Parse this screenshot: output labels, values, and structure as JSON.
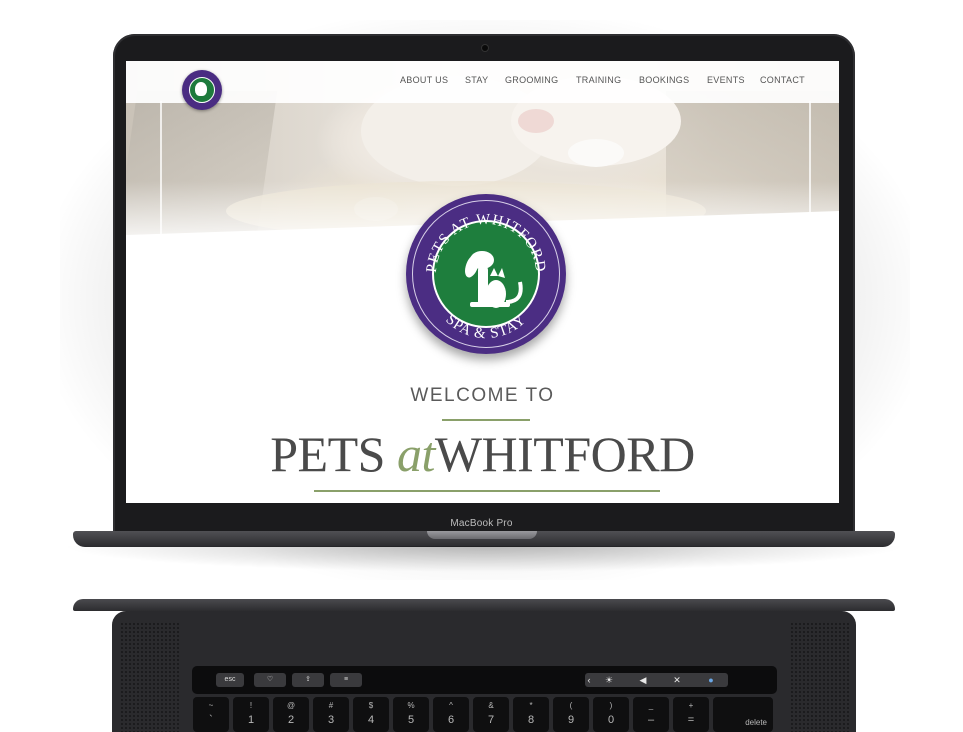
{
  "device": {
    "model_label": "MacBook Pro"
  },
  "website": {
    "nav": {
      "logo_alt": "Pets at Whitford Spa & Stay logo",
      "items": [
        "ABOUT US",
        "STAY",
        "GROOMING",
        "TRAINING",
        "BOOKINGS",
        "EVENTS",
        "CONTACT"
      ]
    },
    "logo": {
      "top_text": "PETS AT WHITFORD",
      "bottom_text": "SPA & STAY"
    },
    "welcome": "WELCOME TO",
    "title": {
      "part1": "PETS",
      "part2": "at",
      "part3": "WHITFORD"
    },
    "colors": {
      "brand_purple": "#4b2d83",
      "brand_green": "#1e7e3d",
      "accent_olive": "#8aa06a"
    }
  },
  "touchbar": {
    "esc": "esc",
    "icons": [
      "heart-icon",
      "share-icon",
      "sliders-icon",
      "chevron-left-icon",
      "brightness-icon",
      "volume-icon",
      "mute-icon",
      "siri-icon"
    ]
  },
  "keyboard": {
    "keys": [
      {
        "top": "~",
        "bot": "`"
      },
      {
        "top": "!",
        "bot": "1"
      },
      {
        "top": "@",
        "bot": "2"
      },
      {
        "top": "#",
        "bot": "3"
      },
      {
        "top": "$",
        "bot": "4"
      },
      {
        "top": "%",
        "bot": "5"
      },
      {
        "top": "^",
        "bot": "6"
      },
      {
        "top": "&",
        "bot": "7"
      },
      {
        "top": "*",
        "bot": "8"
      },
      {
        "top": "(",
        "bot": "9"
      },
      {
        "top": ")",
        "bot": "0"
      },
      {
        "top": "_",
        "bot": "–"
      },
      {
        "top": "+",
        "bot": "="
      }
    ],
    "delete": "delete"
  }
}
